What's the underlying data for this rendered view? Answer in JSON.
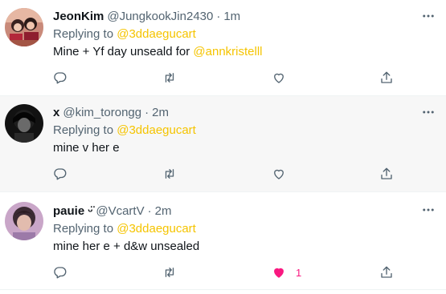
{
  "tweets": [
    {
      "name": "JeonKim",
      "handle": "@JungkookJin2430",
      "time": "1m",
      "replying_prefix": "Replying to ",
      "replying_to": "@3ddaegucart",
      "text_before": "Mine + Yf day unseald for ",
      "text_mention": "@annkristelll",
      "like_count": ""
    },
    {
      "name": "x",
      "handle": "@kim_torongg",
      "time": "2m",
      "replying_prefix": "Replying to ",
      "replying_to": "@3ddaegucart",
      "text_before": "mine v her e",
      "text_mention": "",
      "like_count": ""
    },
    {
      "name": "pauie",
      "name_emoji": "ᵕ̈",
      "handle": "@VcartV",
      "time": "2m",
      "replying_prefix": "Replying to ",
      "replying_to": "@3ddaegucart",
      "text_before": "mine her e + d&w unsealed",
      "text_mention": "",
      "like_count": "1"
    }
  ],
  "separator": "·",
  "colors": {
    "accent_link": "#f5c400",
    "like_active": "#f91880",
    "secondary_text": "#536471",
    "highlight_row": "#f7f7f7"
  },
  "icons": {
    "reply": "reply-icon",
    "retweet": "retweet-icon",
    "like": "heart-icon",
    "share": "share-icon",
    "more": "more-icon"
  }
}
